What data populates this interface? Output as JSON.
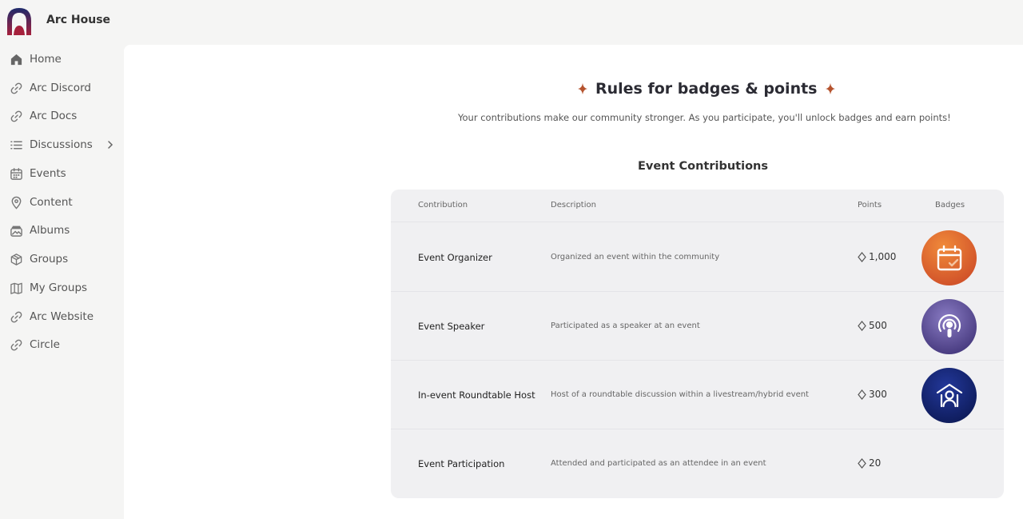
{
  "app": {
    "brand": "Arc House"
  },
  "sidebar": {
    "items": [
      {
        "label": "Home",
        "icon": "home-icon"
      },
      {
        "label": "Arc Discord",
        "icon": "link-icon"
      },
      {
        "label": "Arc Docs",
        "icon": "link-icon"
      },
      {
        "label": "Discussions",
        "icon": "list-icon",
        "has_submenu": true
      },
      {
        "label": "Events",
        "icon": "calendar-icon"
      },
      {
        "label": "Content",
        "icon": "map-pin-icon"
      },
      {
        "label": "Albums",
        "icon": "album-icon"
      },
      {
        "label": "Groups",
        "icon": "cube-icon"
      },
      {
        "label": "My Groups",
        "icon": "map-icon"
      },
      {
        "label": "Arc Website",
        "icon": "link-icon"
      },
      {
        "label": "Circle",
        "icon": "link-icon"
      }
    ]
  },
  "main": {
    "title": "Rules for badges & points",
    "subtitle": "Your contributions make our community stronger. As you participate, you'll unlock badges and earn points!",
    "section_title": "Event Contributions",
    "table": {
      "headers": {
        "contribution": "Contribution",
        "description": "Description",
        "points": "Points",
        "badges": "Badges"
      },
      "rows": [
        {
          "contribution": "Event Organizer",
          "description": "Organized an event within the community",
          "points": "1,000",
          "badge": "calendar-badge-icon"
        },
        {
          "contribution": "Event Speaker",
          "description": "Participated as a speaker at an event",
          "points": "500",
          "badge": "podcast-badge-icon"
        },
        {
          "contribution": "In-event Roundtable Host",
          "description": "Host of a roundtable discussion within a livestream/hybrid event",
          "points": "300",
          "badge": "host-badge-icon"
        },
        {
          "contribution": "Event Participation",
          "description": "Attended and participated as an attendee in an event",
          "points": "20",
          "badge": ""
        }
      ]
    }
  },
  "colors": {
    "accent_sparkle": "#b5532e",
    "badge_organizer": "#e0642e",
    "badge_speaker": "#5b4d94",
    "badge_host": "#14246a"
  }
}
